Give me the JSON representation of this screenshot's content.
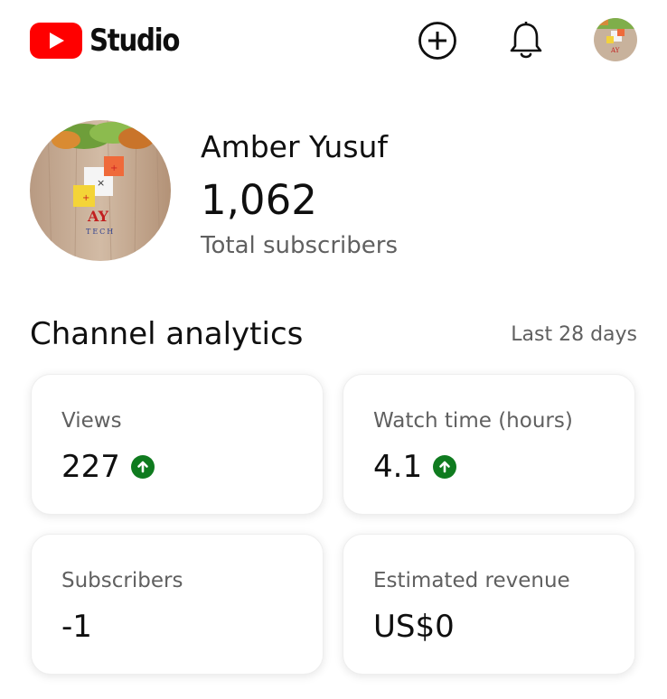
{
  "header": {
    "app_name": "Studio",
    "icons": [
      "youtube-logo-icon",
      "create-plus-icon",
      "bell-icon",
      "avatar"
    ]
  },
  "channel": {
    "name": "Amber Yusuf",
    "subscriber_count": "1,062",
    "subscriber_label": "Total subscribers",
    "avatar_text_main": "AY",
    "avatar_text_sub": "TECH"
  },
  "analytics": {
    "title": "Channel analytics",
    "period": "Last 28 days",
    "cards": [
      {
        "label": "Views",
        "value": "227",
        "trend": "up"
      },
      {
        "label": "Watch time (hours)",
        "value": "4.1",
        "trend": "up"
      },
      {
        "label": "Subscribers",
        "value": "-1",
        "trend": "none"
      },
      {
        "label": "Estimated revenue",
        "value": "US$0",
        "trend": "none"
      }
    ]
  },
  "colors": {
    "brand_red": "#ff0000",
    "trend_up": "#0f7b1f",
    "secondary_text": "#606060"
  }
}
